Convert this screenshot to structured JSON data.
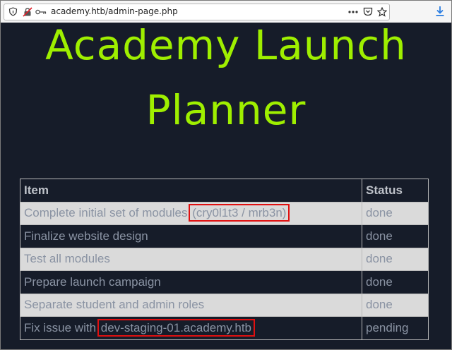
{
  "browser": {
    "url": "academy.htb/admin-page.php",
    "icons": [
      "info-icon",
      "insecure-lock-icon",
      "key-icon",
      "more-actions-icon",
      "pocket-icon",
      "bookmark-star-icon",
      "download-icon"
    ]
  },
  "page": {
    "title_line1": "Academy Launch",
    "title_line2": "Planner",
    "title_color": "#9fef00",
    "highlight_color": "#e01010"
  },
  "table": {
    "headers": [
      "Item",
      "Status"
    ],
    "rows": [
      {
        "item": "Complete initial set of modules ",
        "item_highlight": "(cry0l1t3 / mrb3n)",
        "status": "done"
      },
      {
        "item": "Finalize website design",
        "item_highlight": "",
        "status": "done"
      },
      {
        "item": "Test all modules",
        "item_highlight": "",
        "status": "done"
      },
      {
        "item": "Prepare launch campaign",
        "item_highlight": "",
        "status": "done"
      },
      {
        "item": "Separate student and admin roles",
        "item_highlight": "",
        "status": "done"
      },
      {
        "item": "Fix issue with ",
        "item_highlight": "dev-staging-01.academy.htb",
        "status": "pending"
      }
    ]
  }
}
